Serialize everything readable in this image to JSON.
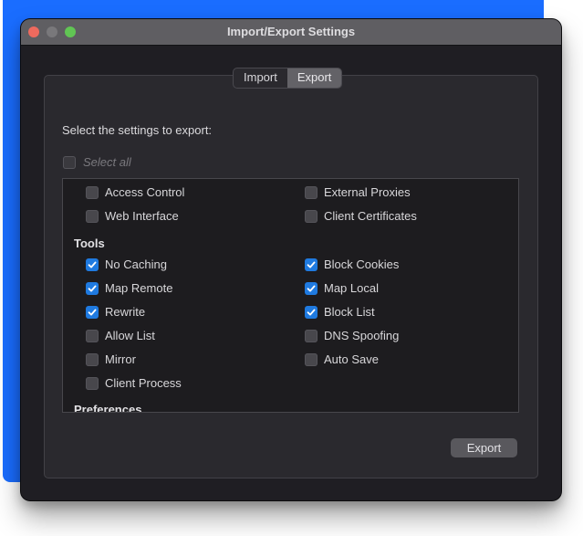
{
  "window": {
    "title": "Import/Export Settings",
    "traffic_lights": [
      "close",
      "minimize",
      "zoom"
    ]
  },
  "tabs": [
    {
      "label": "Import",
      "active": false
    },
    {
      "label": "Export",
      "active": true
    }
  ],
  "heading": "Select the settings to export:",
  "select_all": {
    "label": "Select all",
    "checked": false,
    "disabled": true
  },
  "list": {
    "general": {
      "left": [
        {
          "label": "Access Control",
          "checked": false
        },
        {
          "label": "Web Interface",
          "checked": false
        }
      ],
      "right": [
        {
          "label": "External Proxies",
          "checked": false
        },
        {
          "label": "Client Certificates",
          "checked": false
        }
      ]
    },
    "tools": {
      "title": "Tools",
      "left": [
        {
          "label": "No Caching",
          "checked": true
        },
        {
          "label": "Map Remote",
          "checked": true
        },
        {
          "label": "Rewrite",
          "checked": true
        },
        {
          "label": "Allow List",
          "checked": false
        },
        {
          "label": "Mirror",
          "checked": false
        },
        {
          "label": "Client Process",
          "checked": false
        }
      ],
      "right": [
        {
          "label": "Block Cookies",
          "checked": true
        },
        {
          "label": "Map Local",
          "checked": true
        },
        {
          "label": "Block List",
          "checked": true
        },
        {
          "label": "DNS Spoofing",
          "checked": false
        },
        {
          "label": "Auto Save",
          "checked": false
        }
      ]
    },
    "preferences": {
      "title": "Preferences"
    }
  },
  "export_button": "Export",
  "colors": {
    "accent": "#1f7ae0",
    "backdrop": "#1a6dff",
    "window_bg": "#1f1e23",
    "titlebar": "#5f5e62"
  }
}
